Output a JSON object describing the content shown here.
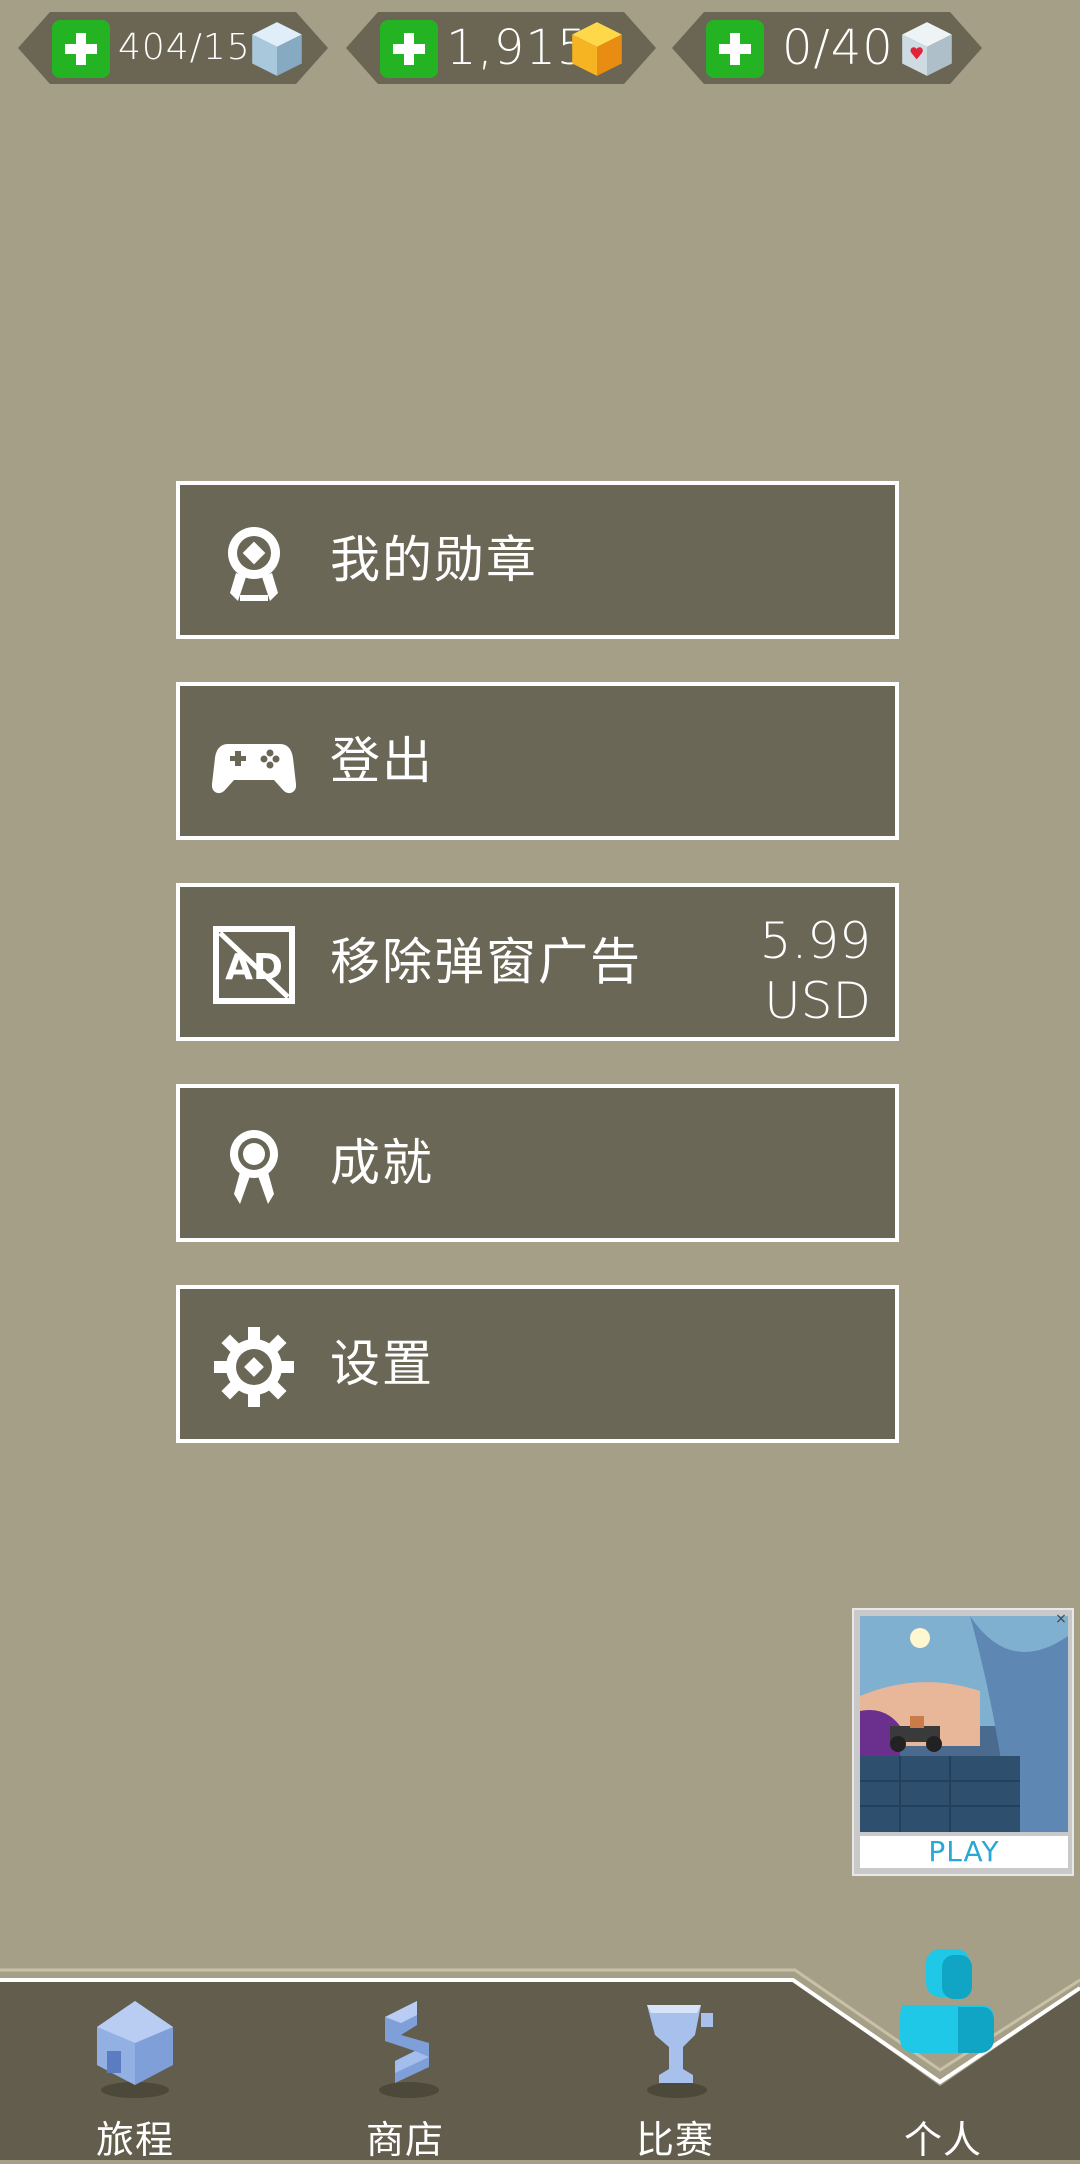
{
  "resources": {
    "energy": {
      "value": "404/15",
      "icon": "blue-cube-icon"
    },
    "coins": {
      "value": "1,915",
      "icon": "gold-cube-icon"
    },
    "lives": {
      "value": "0/40",
      "icon": "heart-cube-icon"
    }
  },
  "menu": {
    "items": [
      {
        "label": "我的勋章",
        "icon": "medal-icon"
      },
      {
        "label": "登出",
        "icon": "gamepad-icon"
      },
      {
        "label": "移除弹窗广告",
        "icon": "no-ads-icon",
        "price": "5.99",
        "currency": "USD"
      },
      {
        "label": "成就",
        "icon": "rosette-icon"
      },
      {
        "label": "设置",
        "icon": "gear-icon"
      }
    ]
  },
  "promo": {
    "label": "PLAY"
  },
  "nav": {
    "items": [
      {
        "label": "旅程",
        "icon": "home-cube-icon"
      },
      {
        "label": "商店",
        "icon": "shop-s-icon"
      },
      {
        "label": "比赛",
        "icon": "trophy-icon"
      },
      {
        "label": "个人",
        "icon": "person-icon",
        "active": true
      }
    ]
  },
  "colors": {
    "background": "#a69f87",
    "button_fill": "#6b6757",
    "button_border": "#ffffff",
    "nav_bg": "#625d4c",
    "plus_green": "#23b323",
    "active_person": "#1ec8e6",
    "play_text": "#29a7d6"
  }
}
